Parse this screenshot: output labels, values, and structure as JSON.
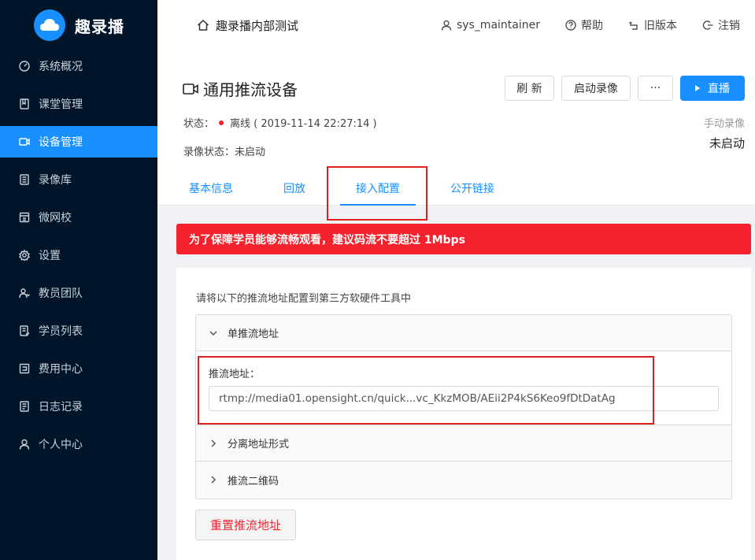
{
  "brand": {
    "name": "趣录播",
    "logo_icon": "cloud-icon",
    "color": "#1890ff"
  },
  "sidebar": {
    "items": [
      {
        "label": "系统概况",
        "icon": "dashboard-icon"
      },
      {
        "label": "课堂管理",
        "icon": "book-icon"
      },
      {
        "label": "设备管理",
        "icon": "video-camera-icon",
        "active": true
      },
      {
        "label": "录像库",
        "icon": "library-icon"
      },
      {
        "label": "微网校",
        "icon": "school-icon"
      },
      {
        "label": "设置",
        "icon": "gear-icon"
      },
      {
        "label": "教员团队",
        "icon": "team-icon"
      },
      {
        "label": "学员列表",
        "icon": "list-icon"
      },
      {
        "label": "费用中心",
        "icon": "billing-icon"
      },
      {
        "label": "日志记录",
        "icon": "log-icon"
      },
      {
        "label": "个人中心",
        "icon": "user-icon"
      }
    ]
  },
  "header": {
    "org_name": "趣录播内部测试",
    "user": "sys_maintainer",
    "help": "帮助",
    "old_version": "旧版本",
    "logout": "注销"
  },
  "device": {
    "title": "通用推流设备",
    "status_label": "状态：",
    "status_value": "离线 ( 2019-11-14 22:27:14 )",
    "status_color": "#f5222d",
    "record_status": "录像状态：未启动",
    "buttons": {
      "refresh": "刷 新",
      "start_record": "启动录像",
      "more": "···",
      "live": "直播"
    },
    "manual_record_label": "手动录像",
    "manual_record_value": "未启动"
  },
  "tabs": [
    {
      "label": "基本信息"
    },
    {
      "label": "回放"
    },
    {
      "label": "接入配置",
      "active": true
    },
    {
      "label": "公开链接"
    }
  ],
  "alert": {
    "text": "为了保障学员能够流畅观看，建议码流不要超过 1Mbps",
    "color": "#f5222d"
  },
  "config": {
    "hint": "请将以下的推流地址配置到第三方软硬件工具中",
    "panels": [
      {
        "title": "单推流地址",
        "expanded": true
      },
      {
        "title": "分离地址形式",
        "expanded": false
      },
      {
        "title": "推流二维码",
        "expanded": false
      }
    ],
    "url_label": "推流地址：",
    "url_value": "rtmp://media01.opensight.cn/quick...vc_KkzMOB/AEii2P4kS6Keo9fDtDatAg",
    "reset_button": "重置推流地址"
  }
}
